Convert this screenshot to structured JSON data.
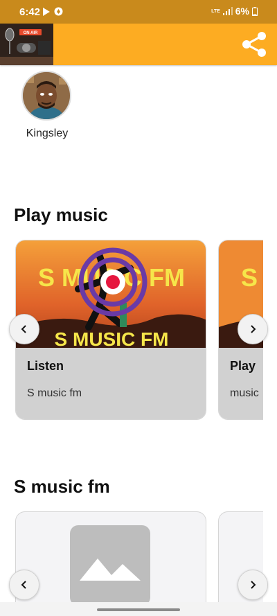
{
  "status_bar": {
    "time": "6:42",
    "network": "LTE",
    "battery": "6%"
  },
  "app_bar": {
    "logo_icon": "radio-studio-logo",
    "share_icon": "share-icon",
    "logo_sign_text": "ON AIR"
  },
  "profile": {
    "name": "Kingsley"
  },
  "sections": {
    "play_music": {
      "title": "Play music",
      "cards": [
        {
          "title": "Listen",
          "subtitle": "S music fm",
          "banner_text": "S MUSIC FM",
          "banner_text_2": "S MUSIC FM"
        },
        {
          "title": "Play",
          "subtitle": "music",
          "banner_text": "S"
        }
      ]
    },
    "s_music_fm": {
      "title": "S music fm"
    }
  },
  "colors": {
    "status_bar": "#c98a1c",
    "app_bar": "#fdac22",
    "card_body": "#d1d1d1"
  }
}
